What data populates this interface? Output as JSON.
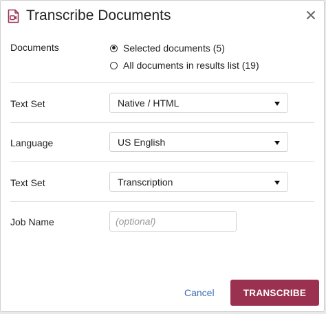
{
  "dialog": {
    "title": "Transcribe Documents",
    "icon": "document-video-icon",
    "close_icon": "close-icon"
  },
  "documents": {
    "label": "Documents",
    "options": [
      {
        "label": "Selected documents (5)",
        "selected": true
      },
      {
        "label": "All documents in results list (19)",
        "selected": false
      }
    ]
  },
  "text_set_1": {
    "label": "Text Set",
    "value": "Native / HTML"
  },
  "language": {
    "label": "Language",
    "value": "US English"
  },
  "text_set_2": {
    "label": "Text Set",
    "value": "Transcription"
  },
  "job_name": {
    "label": "Job Name",
    "value": "",
    "placeholder": "(optional)"
  },
  "footer": {
    "cancel_label": "Cancel",
    "submit_label": "TRANSCRIBE"
  },
  "colors": {
    "accent": "#9b3151",
    "link": "#3d6bb3",
    "icon": "#9b3151"
  }
}
